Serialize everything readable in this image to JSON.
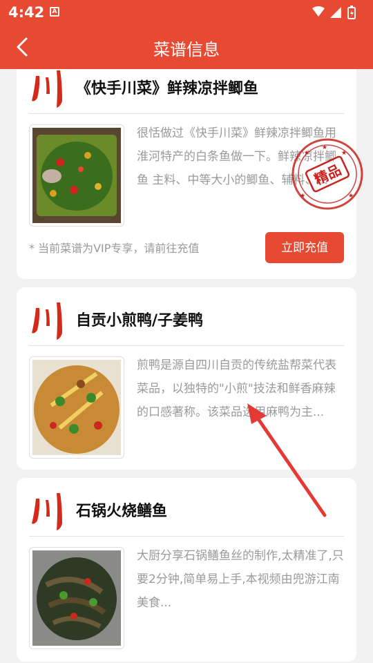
{
  "status": {
    "time": "4:42",
    "app_badge": "A"
  },
  "header": {
    "title": "菜谱信息"
  },
  "recipes": [
    {
      "title": "《快手川菜》鲜辣凉拌鲫鱼",
      "description": "很恬做过《快手川菜》鲜辣凉拌鲫鱼用淮河特产的白条鱼做一下。鲜辣凉拌鲫鱼 主料、中等大小的鲫鱼、辅料、...",
      "vip_note": "* 当前菜谱为VIP专享，请前往充值",
      "action_label": "立即充值",
      "stamp_text": "精品",
      "colors": {
        "dish": "#3a6e1c"
      }
    },
    {
      "title": "自贡小煎鸭/子姜鸭",
      "description": "煎鸭是源自四川自贡的传统盐帮菜代表菜品，以独特的\"小煎\"技法和鲜香麻辣的口感著称。该菜品选用麻鸭为主...",
      "colors": {
        "dish": "#c88a35"
      }
    },
    {
      "title": "石锅火烧鳝鱼",
      "description": "大厨分享石锅鳝鱼丝的制作,太精准了,只要2分钟,简单易上手,本视频由兜游江南美食...",
      "colors": {
        "dish": "#2e3a24"
      }
    }
  ],
  "colors": {
    "primary": "#e64a33",
    "chuan_mark": "#d42a1a",
    "stamp": "#c8221c"
  },
  "icons": [
    "back-arrow-icon",
    "wifi-icon",
    "signal-icon",
    "battery-icon",
    "chuan-icon",
    "premium-stamp-icon",
    "pointer-arrow-icon"
  ]
}
